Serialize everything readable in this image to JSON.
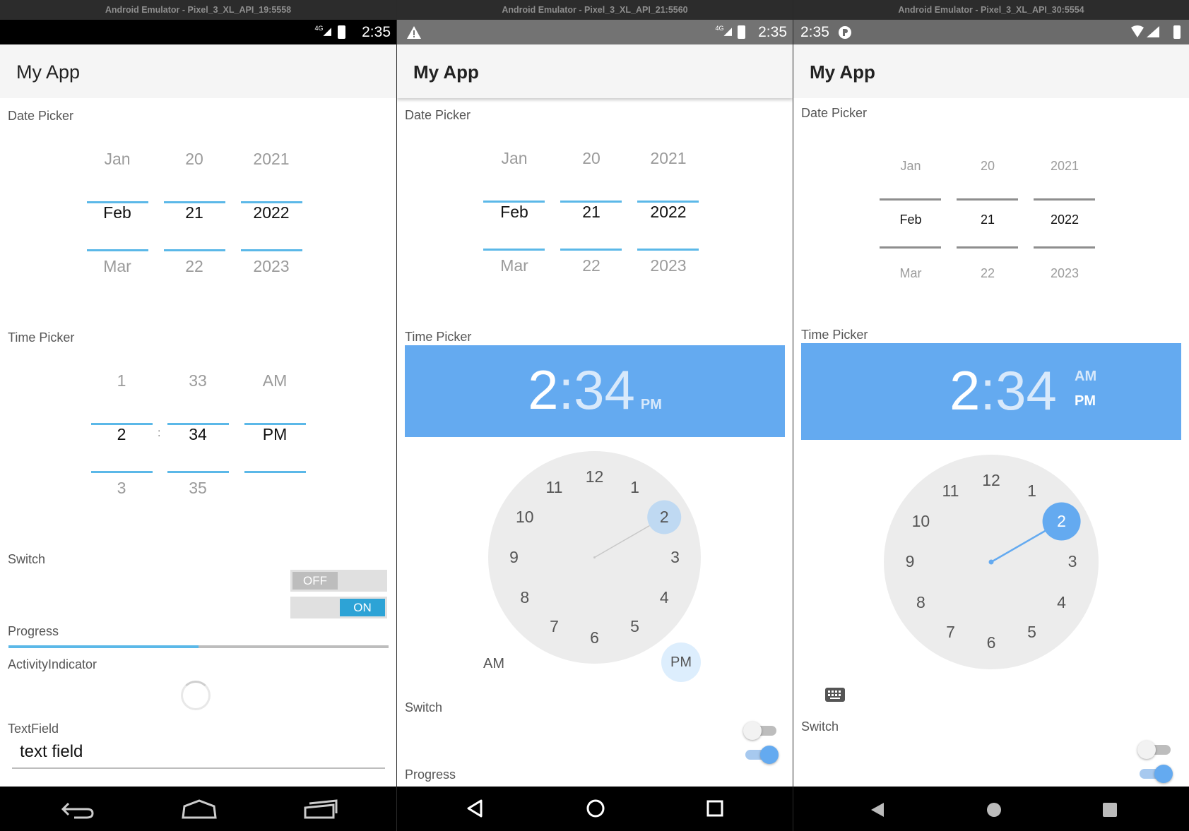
{
  "emulators": [
    {
      "window_title": "Android Emulator - Pixel_3_XL_API_19:5558",
      "status_time": "2:35",
      "status_net": "4G",
      "app_title": "My App",
      "date_label": "Date Picker",
      "date": {
        "months": [
          "Jan",
          "Feb",
          "Mar"
        ],
        "days": [
          "20",
          "21",
          "22"
        ],
        "years": [
          "2021",
          "2022",
          "2023"
        ]
      },
      "time_label": "Time Picker",
      "time": {
        "hours": [
          "1",
          "2",
          "3"
        ],
        "separator": ":",
        "minutes": [
          "33",
          "34",
          "35"
        ],
        "ampm": [
          "AM",
          "PM"
        ]
      },
      "switch_label": "Switch",
      "switch_off": "OFF",
      "switch_on": "ON",
      "progress_label": "Progress",
      "progress_value": 0.5,
      "activity_label": "ActivityIndicator",
      "textfield_label": "TextField",
      "textfield_value": "text field"
    },
    {
      "window_title": "Android Emulator - Pixel_3_XL_API_21:5560",
      "status_time": "2:35",
      "status_net": "4G",
      "app_title": "My App",
      "date_label": "Date Picker",
      "date": {
        "months": [
          "Jan",
          "Feb",
          "Mar"
        ],
        "days": [
          "20",
          "21",
          "22"
        ],
        "years": [
          "2021",
          "2022",
          "2023"
        ]
      },
      "time_label": "Time Picker",
      "time_hour": "2",
      "time_sep": ":",
      "time_minute": "34",
      "time_ampm": "PM",
      "dial_numbers": [
        "12",
        "1",
        "2",
        "3",
        "4",
        "5",
        "6",
        "7",
        "8",
        "9",
        "10",
        "11"
      ],
      "selected_hour": "2",
      "am_label": "AM",
      "pm_label": "PM",
      "switch_label": "Switch",
      "progress_label": "Progress"
    },
    {
      "window_title": "Android Emulator - Pixel_3_XL_API_30:5554",
      "status_time": "2:35",
      "app_title": "My App",
      "date_label": "Date Picker",
      "date": {
        "months": [
          "Jan",
          "Feb",
          "Mar"
        ],
        "days": [
          "20",
          "21",
          "22"
        ],
        "years": [
          "2021",
          "2022",
          "2023"
        ]
      },
      "time_label": "Time Picker",
      "time_hour": "2",
      "time_sep": ":",
      "time_minute": "34",
      "am_label": "AM",
      "pm_label": "PM",
      "dial_numbers": [
        "12",
        "1",
        "2",
        "3",
        "4",
        "5",
        "6",
        "7",
        "8",
        "9",
        "10",
        "11"
      ],
      "selected_hour": "2",
      "switch_label": "Switch"
    }
  ],
  "colors": {
    "accent_blue": "#5bb8e8",
    "header_blue": "#64aaf0",
    "dial_bg": "#ececec",
    "clock_hand": "#64aaf0"
  },
  "icons": {
    "back": "back-icon",
    "home": "home-icon",
    "recents": "recents-icon",
    "warning": "warning-icon",
    "keyboard": "keyboard-icon"
  }
}
